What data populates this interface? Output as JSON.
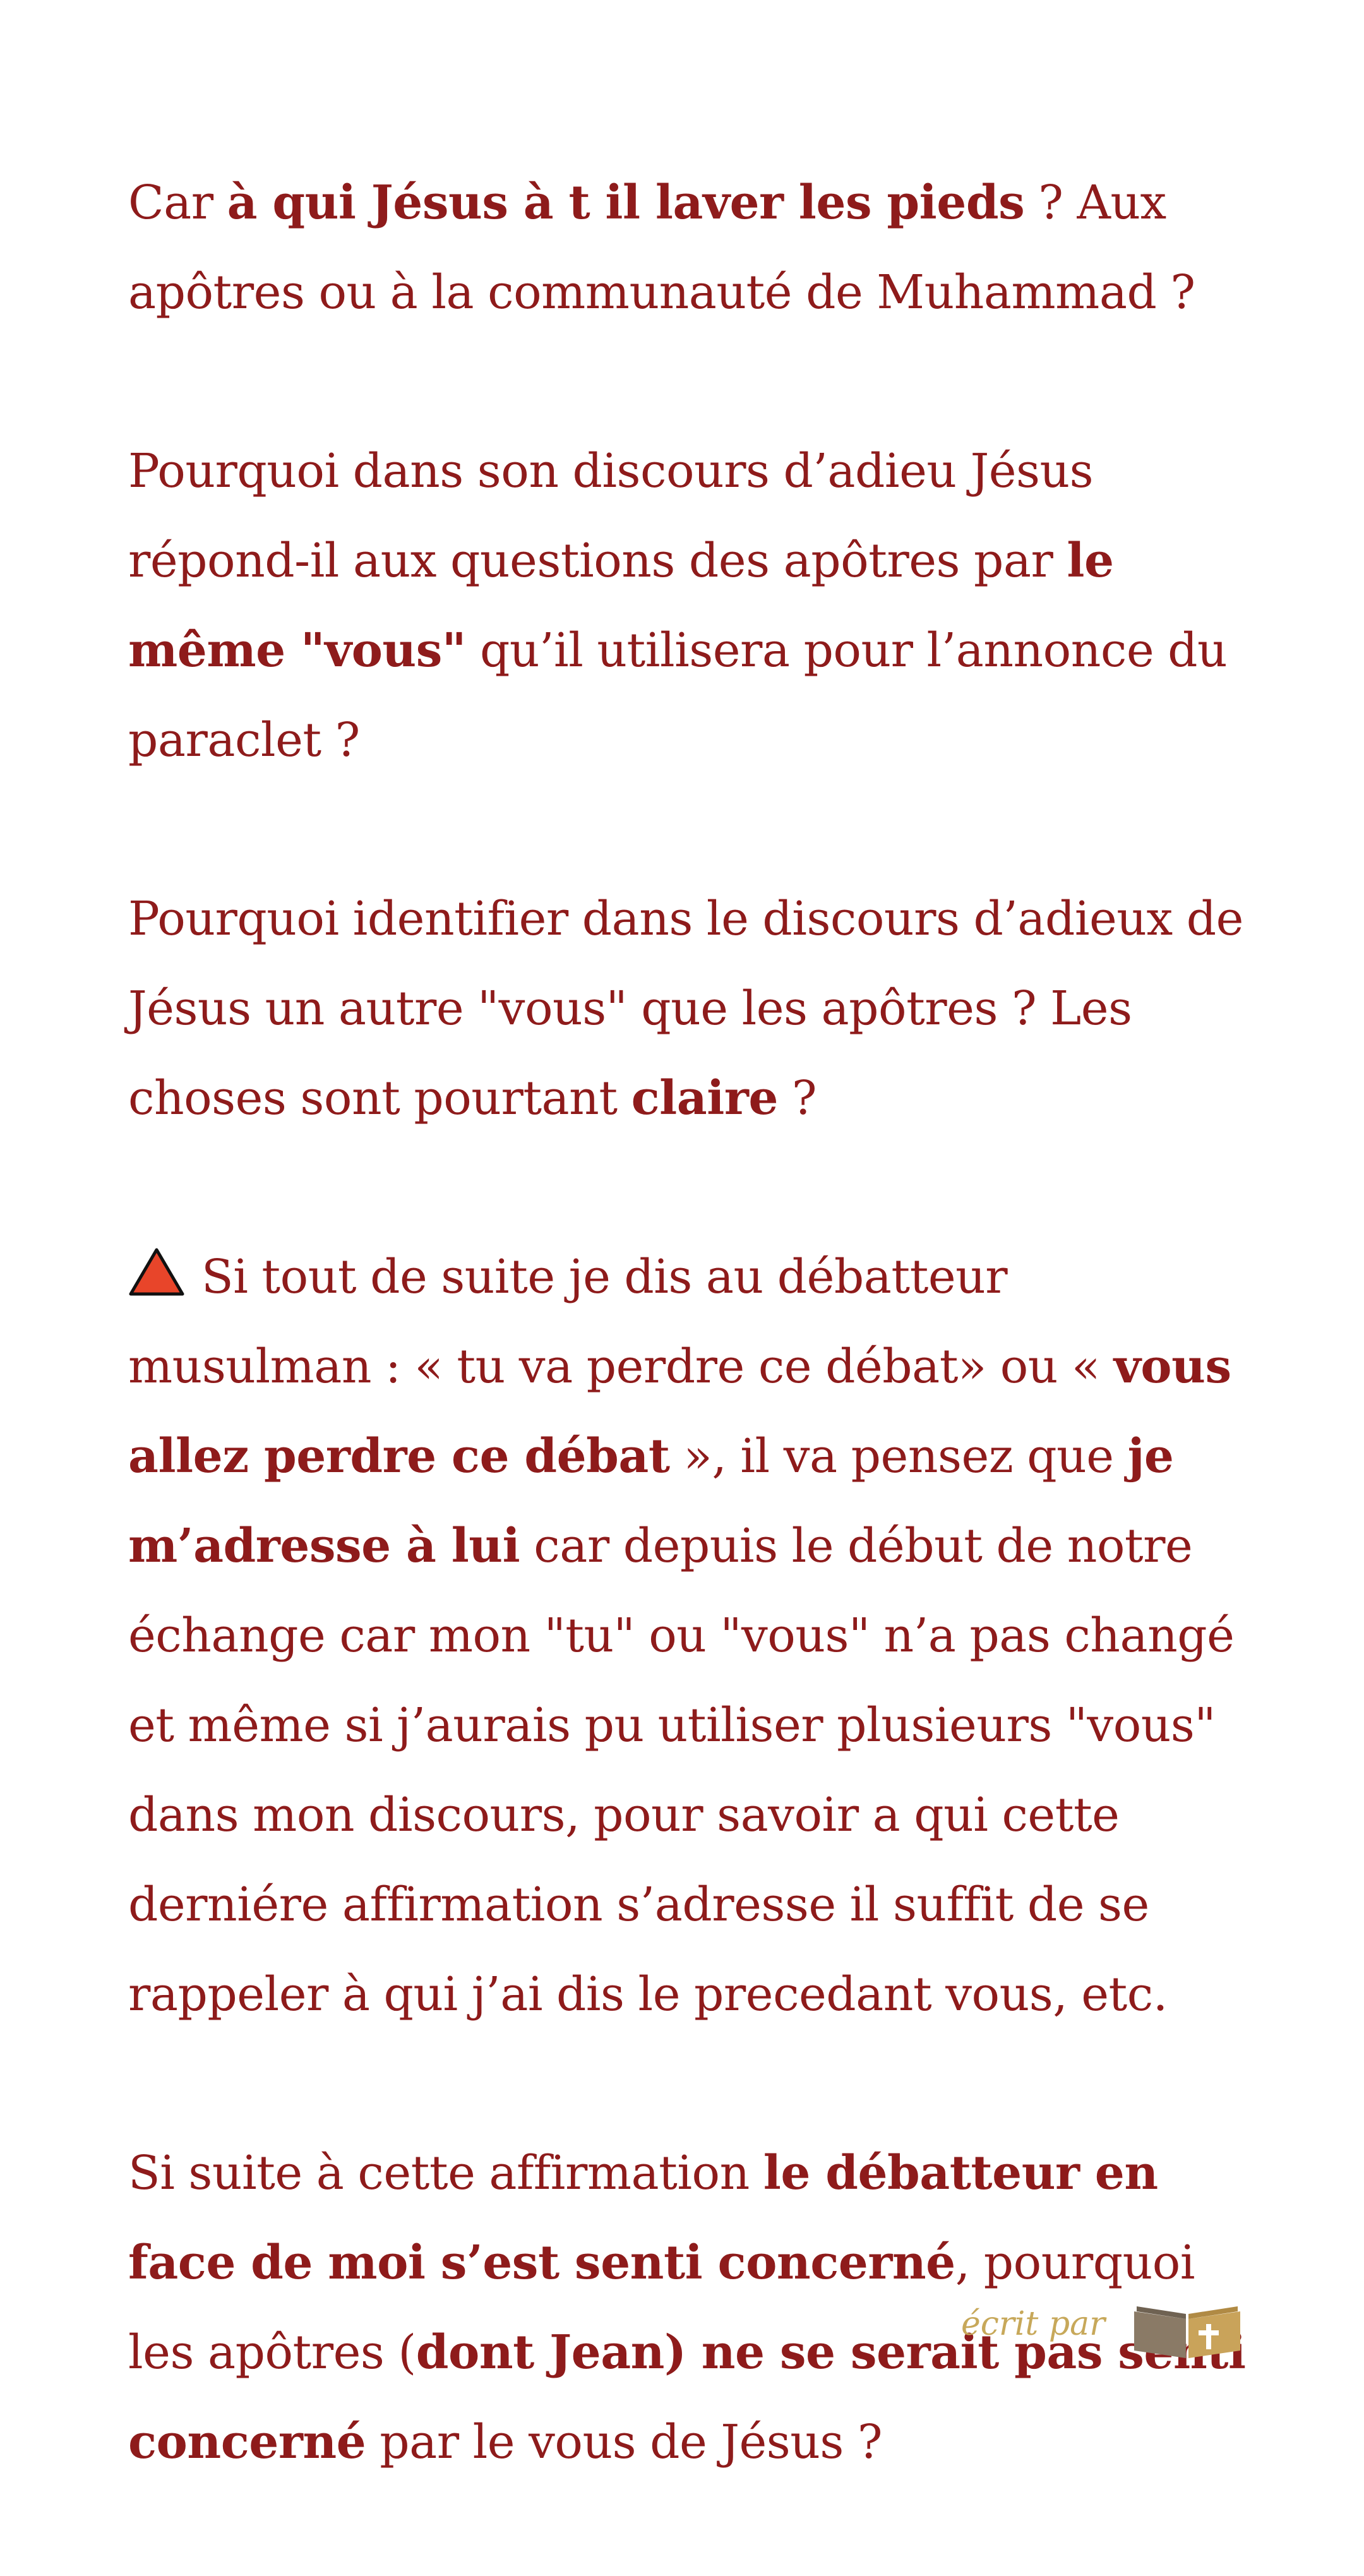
{
  "paragraphs": [
    {
      "id": "p1",
      "segments": [
        {
          "text": "Car ",
          "bold": false
        },
        {
          "text": "à qui Jésus à t il laver les pieds",
          "bold": true
        },
        {
          "text": " ? Aux apôtres ou à la communauté de Muhammad ?",
          "bold": false
        }
      ]
    },
    {
      "id": "p2",
      "segments": [
        {
          "text": "Pourquoi dans son discours d’adieu Jésus répond-il aux questions des apôtres par ",
          "bold": false
        },
        {
          "text": "le même \"vous\"",
          "bold": true
        },
        {
          "text": " qu’il utilisera pour l’annonce du paraclet ?",
          "bold": false
        }
      ]
    },
    {
      "id": "p3",
      "segments": [
        {
          "text": "Pourquoi identifier dans le discours d’adieux de Jésus un autre \"vous\" que les apôtres ? Les choses sont pourtant ",
          "bold": false
        },
        {
          "text": "claire",
          "bold": true
        },
        {
          "text": " ?",
          "bold": false
        }
      ]
    },
    {
      "id": "p4",
      "icon": "warning-triangle-icon",
      "segments": [
        {
          "text": "Si tout de suite je dis au débatteur musulman : « tu va perdre ce débat» ou « ",
          "bold": false
        },
        {
          "text": "vous allez perdre ce débat",
          "bold": true
        },
        {
          "text": " », il va pensez que ",
          "bold": false
        },
        {
          "text": "je m’adresse à lui",
          "bold": true
        },
        {
          "text": " car depuis le début de notre échange car mon \"tu\" ou \"vous\" n’a pas changé et même si j’aurais pu utiliser plusieurs \"vous\" dans mon discours, pour savoir a qui cette derniére affirmation s’adresse il suffit de se rappeler à qui j’ai dis le precedant vous, etc.",
          "bold": false
        }
      ]
    },
    {
      "id": "p5",
      "segments": [
        {
          "text": "Si suite à cette affirmation ",
          "bold": false
        },
        {
          "text": "le débatteur en face de moi s’est senti concerné",
          "bold": true
        },
        {
          "text": ", pourquoi les apôtres (",
          "bold": false
        },
        {
          "text": "dont Jean) ne se serait pas senti concerné",
          "bold": true
        },
        {
          "text": " par le vous de Jésus ?",
          "bold": false
        }
      ]
    }
  ],
  "footer": {
    "credit": "écrit par",
    "logo_icon": "open-book-cross-icon"
  },
  "colors": {
    "text": "#8e1b1b",
    "warning_fill": "#e8452a",
    "credit": "#c7a85a"
  }
}
